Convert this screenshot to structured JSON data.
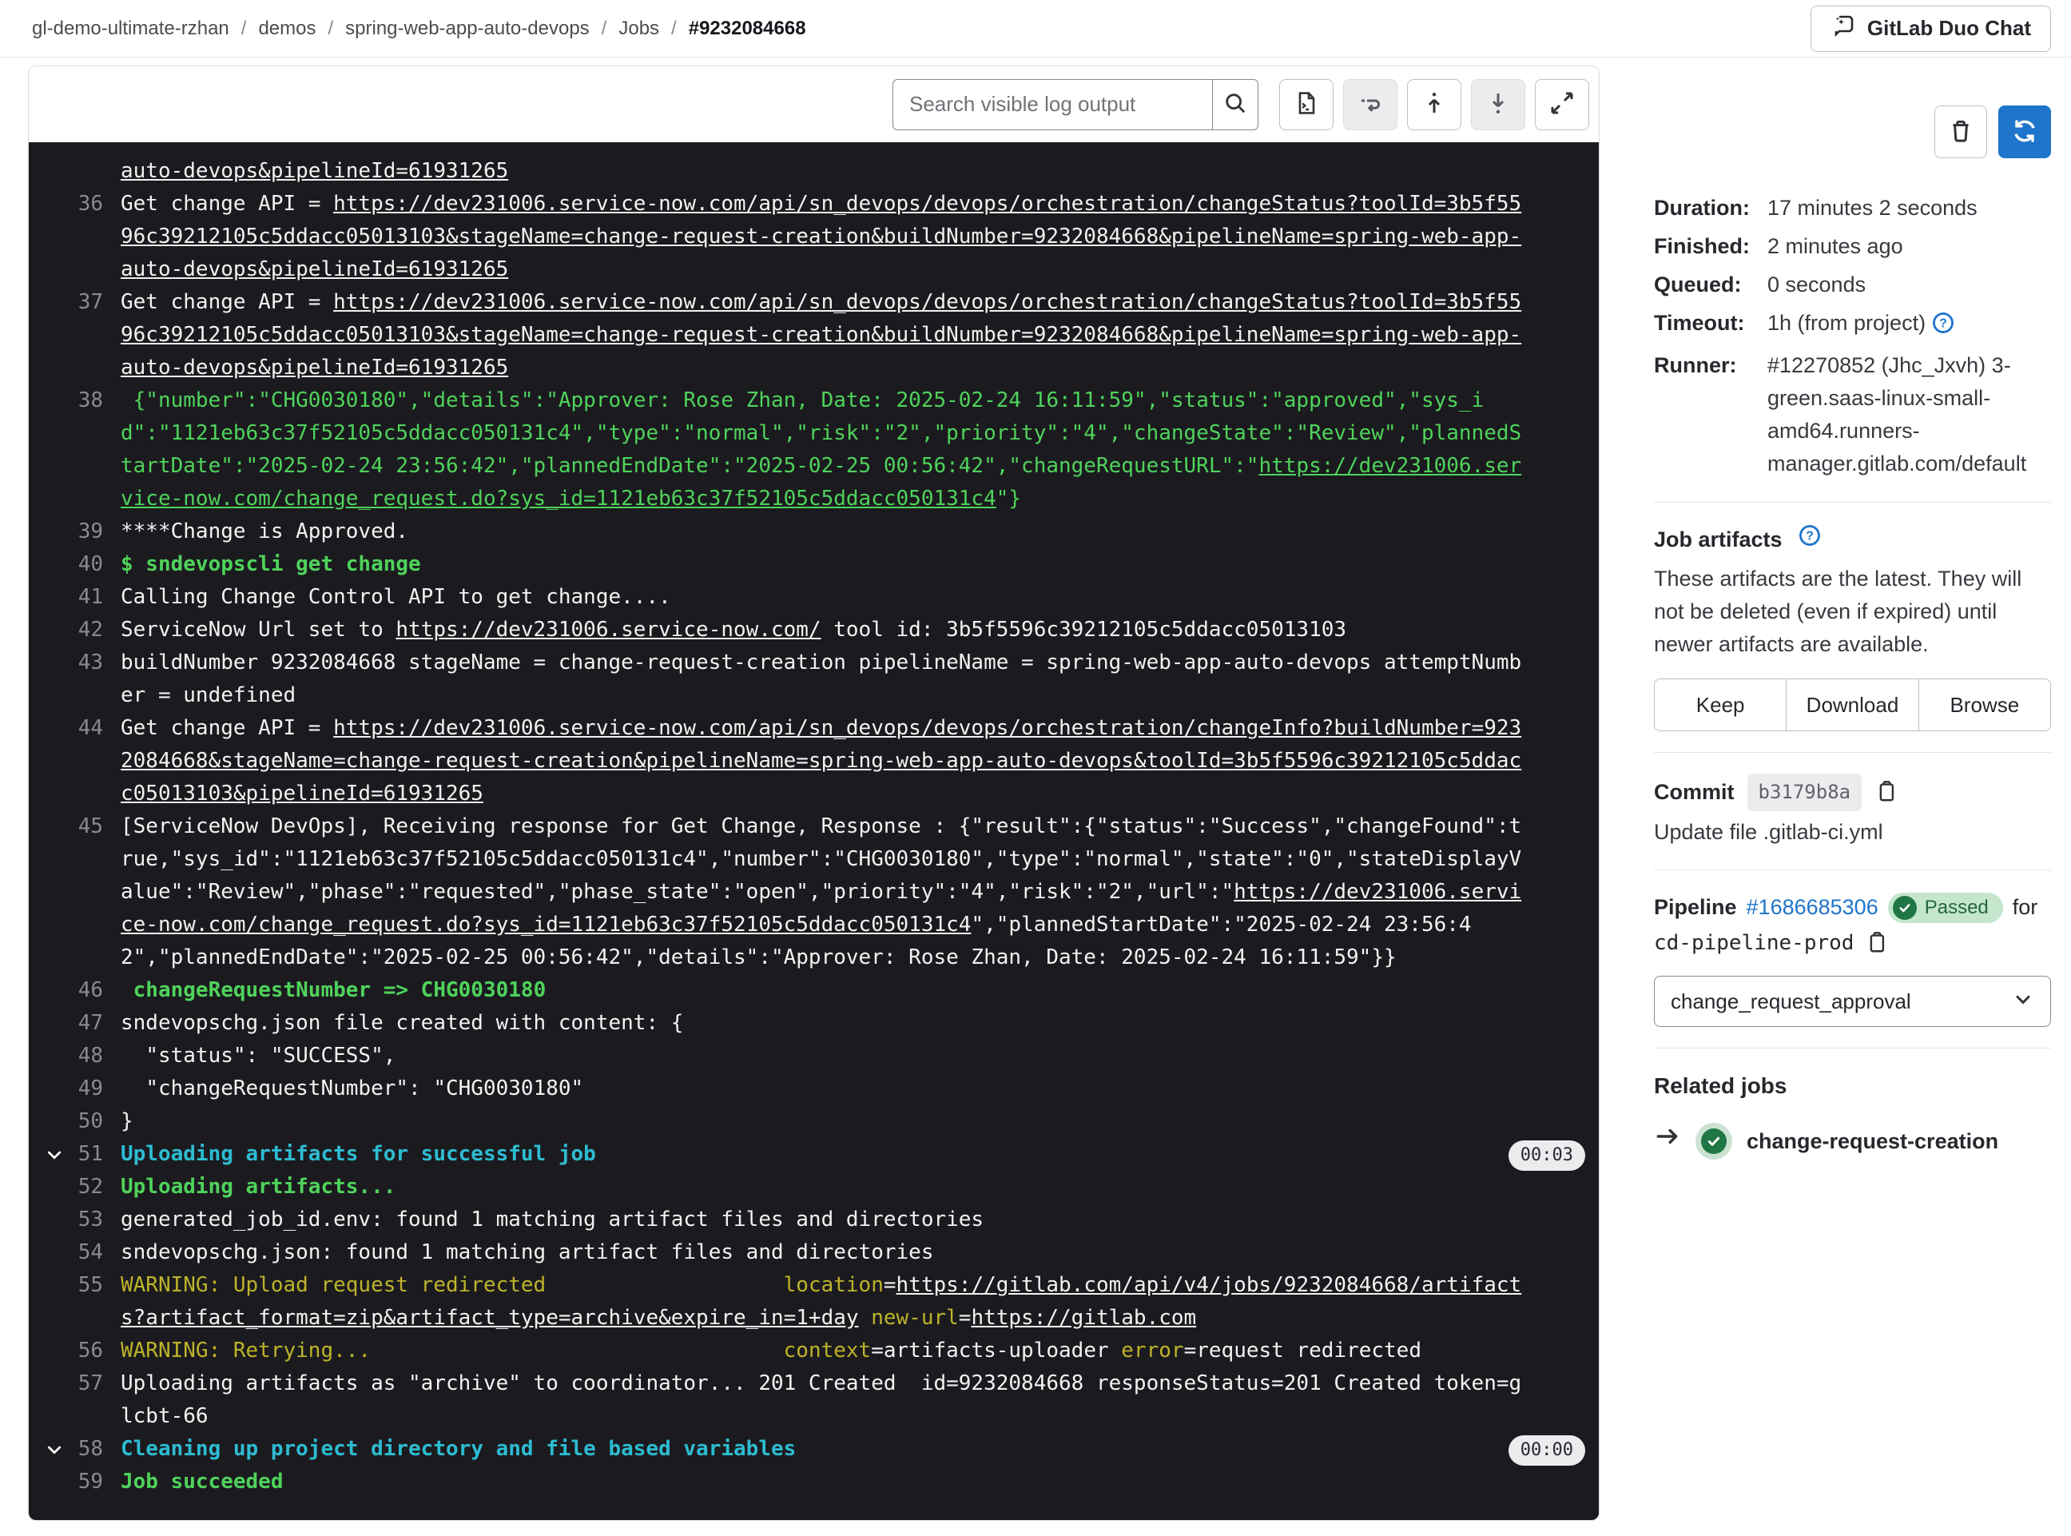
{
  "breadcrumb": {
    "items": [
      "gl-demo-ultimate-rzhan",
      "demos",
      "spring-web-app-auto-devops",
      "Jobs"
    ],
    "current": "#9232084668",
    "separator": "/"
  },
  "header": {
    "duo_chat_label": "GitLab Duo Chat"
  },
  "toolbar": {
    "search_placeholder": "Search visible log output"
  },
  "sidebar": {
    "details": [
      {
        "label": "Duration:",
        "value": "17 minutes 2 seconds",
        "help": false
      },
      {
        "label": "Finished:",
        "value": "2 minutes ago",
        "help": false
      },
      {
        "label": "Queued:",
        "value": "0 seconds",
        "help": false
      },
      {
        "label": "Timeout:",
        "value": "1h (from project)",
        "help": true
      },
      {
        "label": "Runner:",
        "value": "#12270852 (Jhc_Jxvh) 3-green.saas-linux-small-amd64.runners-manager.gitlab.com/default",
        "help": false
      }
    ],
    "artifacts": {
      "title": "Job artifacts",
      "description": "These artifacts are the latest. They will not be deleted (even if expired) until newer artifacts are available.",
      "buttons": [
        "Keep",
        "Download",
        "Browse"
      ]
    },
    "commit": {
      "label": "Commit",
      "sha": "b3179b8a",
      "message": "Update file .gitlab-ci.yml"
    },
    "pipeline": {
      "label": "Pipeline",
      "id": "#1686685306",
      "status": "Passed",
      "for_text": "for",
      "ref": "cd-pipeline-prod",
      "stage_dropdown": "change_request_approval"
    },
    "related_jobs": {
      "title": "Related jobs",
      "jobs": [
        {
          "name": "change-request-creation",
          "status": "success"
        }
      ]
    }
  },
  "log": {
    "lines": [
      {
        "n": null,
        "chev": false,
        "dur": null,
        "seg": [
          {
            "s": "u",
            "t": "auto-devops&pipelineId=61931265"
          }
        ]
      },
      {
        "n": 36,
        "chev": false,
        "dur": null,
        "seg": [
          {
            "s": "w",
            "t": "Get change API = "
          },
          {
            "s": "u",
            "t": "https://dev231006.service-now.com/api/sn_devops/devops/orchestration/changeStatus?toolId=3b5f5596c39212105c5ddacc05013103&stageName=change-request-creation&buildNumber=9232084668&pipelineName=spring-web-app-auto-devops&pipelineId=61931265"
          }
        ]
      },
      {
        "n": 37,
        "chev": false,
        "dur": null,
        "seg": [
          {
            "s": "w",
            "t": "Get change API = "
          },
          {
            "s": "u",
            "t": "https://dev231006.service-now.com/api/sn_devops/devops/orchestration/changeStatus?toolId=3b5f5596c39212105c5ddacc05013103&stageName=change-request-creation&buildNumber=9232084668&pipelineName=spring-web-app-auto-devops&pipelineId=61931265"
          }
        ]
      },
      {
        "n": 38,
        "chev": false,
        "dur": null,
        "seg": [
          {
            "s": "g",
            "t": " {\"number\":\"CHG0030180\",\"details\":\"Approver: Rose Zhan, Date: 2025-02-24 16:11:59\",\"status\":\"approved\",\"sys_id\":\"1121eb63c37f52105c5ddacc050131c4\",\"type\":\"normal\",\"risk\":\"2\",\"priority\":\"4\",\"changeState\":\"Review\",\"plannedStartDate\":\"2025-02-24 23:56:42\",\"plannedEndDate\":\"2025-02-25 00:56:42\",\"changeRequestURL\":\""
          },
          {
            "s": "gu",
            "t": "https://dev231006.service-now.com/change_request.do?sys_id=1121eb63c37f52105c5ddacc050131c4"
          },
          {
            "s": "g",
            "t": "\"}"
          }
        ]
      },
      {
        "n": 39,
        "chev": false,
        "dur": null,
        "seg": [
          {
            "s": "w",
            "t": "****Change is Approved."
          }
        ]
      },
      {
        "n": 40,
        "chev": false,
        "dur": null,
        "seg": [
          {
            "s": "sgb",
            "t": "$ sndevopscli get change"
          }
        ]
      },
      {
        "n": 41,
        "chev": false,
        "dur": null,
        "seg": [
          {
            "s": "w",
            "t": "Calling Change Control API to get change...."
          }
        ]
      },
      {
        "n": 42,
        "chev": false,
        "dur": null,
        "seg": [
          {
            "s": "w",
            "t": "ServiceNow Url set to "
          },
          {
            "s": "u",
            "t": "https://dev231006.service-now.com/"
          },
          {
            "s": "w",
            "t": " tool id: 3b5f5596c39212105c5ddacc05013103"
          }
        ]
      },
      {
        "n": 43,
        "chev": false,
        "dur": null,
        "seg": [
          {
            "s": "w",
            "t": "buildNumber 9232084668 stageName = change-request-creation pipelineName = spring-web-app-auto-devops attemptNumber = undefined"
          }
        ]
      },
      {
        "n": 44,
        "chev": false,
        "dur": null,
        "seg": [
          {
            "s": "w",
            "t": "Get change API = "
          },
          {
            "s": "u",
            "t": "https://dev231006.service-now.com/api/sn_devops/devops/orchestration/changeInfo?buildNumber=9232084668&stageName=change-request-creation&pipelineName=spring-web-app-auto-devops&toolId=3b5f5596c39212105c5ddacc05013103&pipelineId=61931265"
          }
        ]
      },
      {
        "n": 45,
        "chev": false,
        "dur": null,
        "seg": [
          {
            "s": "w",
            "t": "[ServiceNow DevOps], Receiving response for Get Change, Response : {\"result\":{\"status\":\"Success\",\"changeFound\":true,\"sys_id\":\"1121eb63c37f52105c5ddacc050131c4\",\"number\":\"CHG0030180\",\"type\":\"normal\",\"state\":\"0\",\"stateDisplayValue\":\"Review\",\"phase\":\"requested\",\"phase_state\":\"open\",\"priority\":\"4\",\"risk\":\"2\",\"url\":\""
          },
          {
            "s": "u",
            "t": "https://dev231006.service-now.com/change_request.do?sys_id=1121eb63c37f52105c5ddacc050131c4"
          },
          {
            "s": "w",
            "t": "\",\"plannedStartDate\":\"2025-02-24 23:56:42\",\"plannedEndDate\":\"2025-02-25 00:56:42\",\"details\":\"Approver: Rose Zhan, Date: 2025-02-24 16:11:59\"}}"
          }
        ]
      },
      {
        "n": 46,
        "chev": false,
        "dur": null,
        "seg": [
          {
            "s": "sgb",
            "t": " changeRequestNumber => CHG0030180"
          }
        ]
      },
      {
        "n": 47,
        "chev": false,
        "dur": null,
        "seg": [
          {
            "s": "w",
            "t": "sndevopschg.json file created with content: {"
          }
        ]
      },
      {
        "n": 48,
        "chev": false,
        "dur": null,
        "seg": [
          {
            "s": "w",
            "t": "  \"status\": \"SUCCESS\","
          }
        ]
      },
      {
        "n": 49,
        "chev": false,
        "dur": null,
        "seg": [
          {
            "s": "w",
            "t": "  \"changeRequestNumber\": \"CHG0030180\""
          }
        ]
      },
      {
        "n": 50,
        "chev": false,
        "dur": null,
        "seg": [
          {
            "s": "w",
            "t": "}"
          }
        ]
      },
      {
        "n": 51,
        "chev": true,
        "dur": "00:03",
        "seg": [
          {
            "s": "sc",
            "t": "Uploading artifacts for successful job"
          }
        ]
      },
      {
        "n": 52,
        "chev": false,
        "dur": null,
        "seg": [
          {
            "s": "sgb",
            "t": "Uploading artifacts..."
          }
        ]
      },
      {
        "n": 53,
        "chev": false,
        "dur": null,
        "seg": [
          {
            "s": "w",
            "t": "generated_job_id.env: found 1 matching artifact files and directories"
          }
        ]
      },
      {
        "n": 54,
        "chev": false,
        "dur": null,
        "seg": [
          {
            "s": "w",
            "t": "sndevopschg.json: found 1 matching artifact files and directories"
          }
        ]
      },
      {
        "n": 55,
        "chev": false,
        "dur": null,
        "seg": [
          {
            "s": "y",
            "t": "WARNING: Upload request redirected"
          },
          {
            "s": "w",
            "t": "                   "
          },
          {
            "s": "y",
            "t": "location"
          },
          {
            "s": "w",
            "t": "="
          },
          {
            "s": "u",
            "t": "https://gitlab.com/api/v4/jobs/9232084668/artifacts?artifact_format=zip&artifact_type=archive&expire_in=1+day"
          },
          {
            "s": "w",
            "t": " "
          },
          {
            "s": "y",
            "t": "new-url"
          },
          {
            "s": "w",
            "t": "="
          },
          {
            "s": "u",
            "t": "https://gitlab.com"
          }
        ]
      },
      {
        "n": 56,
        "chev": false,
        "dur": null,
        "seg": [
          {
            "s": "y",
            "t": "WARNING: Retrying..."
          },
          {
            "s": "w",
            "t": "                                 "
          },
          {
            "s": "y",
            "t": "context"
          },
          {
            "s": "w",
            "t": "=artifacts-uploader "
          },
          {
            "s": "y",
            "t": "error"
          },
          {
            "s": "w",
            "t": "=request redirected"
          }
        ]
      },
      {
        "n": 57,
        "chev": false,
        "dur": null,
        "seg": [
          {
            "s": "w",
            "t": "Uploading artifacts as \"archive\" to coordinator... 201 Created  id=9232084668 responseStatus=201 Created token=glcbt-66"
          }
        ]
      },
      {
        "n": 58,
        "chev": true,
        "dur": "00:00",
        "seg": [
          {
            "s": "sc",
            "t": "Cleaning up project directory and file based variables"
          }
        ]
      },
      {
        "n": 59,
        "chev": false,
        "dur": null,
        "seg": [
          {
            "s": "sgb",
            "t": "Job succeeded"
          }
        ]
      }
    ]
  }
}
